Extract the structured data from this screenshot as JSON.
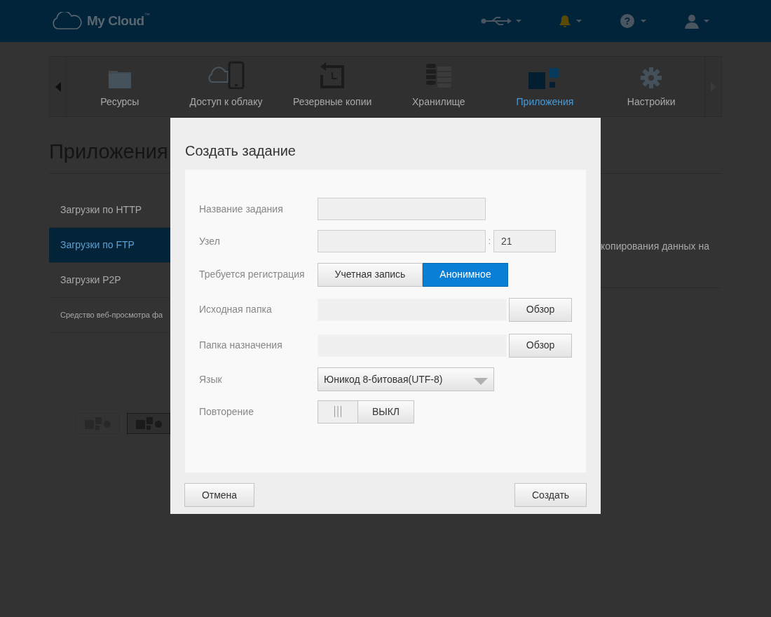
{
  "header": {
    "logo": "My Cloud",
    "trademark": "™",
    "help": "?"
  },
  "nav": {
    "tabs": [
      {
        "label": "Ресурсы",
        "selected": false
      },
      {
        "label": "Доступ к облаку",
        "selected": false
      },
      {
        "label": "Резервные копии",
        "selected": false
      },
      {
        "label": "Хранилище",
        "selected": false
      },
      {
        "label": "Приложения",
        "selected": true
      },
      {
        "label": "Настройки",
        "selected": false
      }
    ]
  },
  "page": {
    "title": "Приложения",
    "apps": [
      {
        "label": "Загрузки по HTTP",
        "selected": false
      },
      {
        "label": "Загрузки по FTP",
        "selected": true
      },
      {
        "label": "Загрузки P2P",
        "selected": false
      },
      {
        "label": "Средство веб-просмотра фа",
        "selected": false
      }
    ],
    "description": "копирования данных на",
    "view_buttons": [
      {
        "selected": false
      },
      {
        "selected": true
      }
    ]
  },
  "dialog": {
    "title": "Создать задание",
    "fields": [
      {
        "kind": "text",
        "label": "Название задания"
      },
      {
        "kind": "host",
        "label": "Узел",
        "separator": ":",
        "port": "21"
      },
      {
        "kind": "segmented",
        "label": "Требуется регистрация",
        "options": [
          {
            "label": "Учетная запись",
            "selected": false
          },
          {
            "label": "Анонимное",
            "selected": true
          }
        ]
      },
      {
        "kind": "folder",
        "label": "Исходная папка",
        "button": "Обзор"
      },
      {
        "kind": "folder",
        "label": "Папка назначения",
        "button": "Обзор"
      },
      {
        "kind": "select",
        "label": "Язык",
        "value": "Юникод 8-битовая(UTF-8)"
      },
      {
        "kind": "toggle",
        "label": "Повторение",
        "on": false,
        "state_label": "ВЫКЛ"
      }
    ],
    "cancel": "Отмена",
    "submit": "Создать"
  }
}
